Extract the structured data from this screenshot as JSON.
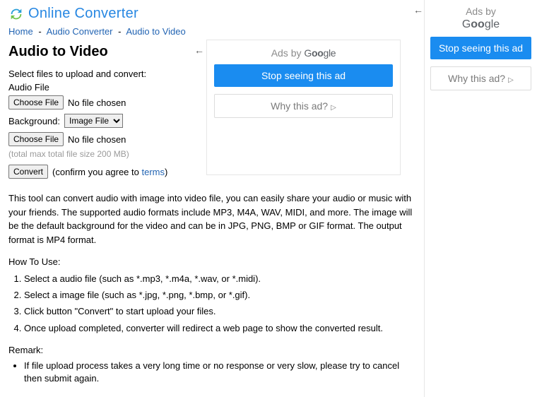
{
  "brand": "Online Converter",
  "breadcrumbs": {
    "home": "Home",
    "audio_converter": "Audio Converter",
    "current": "Audio to Video",
    "sep": "-"
  },
  "title": "Audio to Video",
  "form": {
    "select_files": "Select files to upload and convert:",
    "audio_label": "Audio File",
    "choose_file": "Choose File",
    "no_file": "No file chosen",
    "background_label": "Background:",
    "background_selected": "Image File",
    "max_hint": "(total max total file size 200 MB)",
    "convert": "Convert",
    "confirm_prefix": "(confirm you agree to ",
    "terms": "terms",
    "confirm_suffix": ")"
  },
  "ad": {
    "ads_by": "Ads by ",
    "google": "Google",
    "stop": "Stop seeing this ad",
    "why": "Why this ad?",
    "tri": "▷"
  },
  "description": "This tool can convert audio with image into video file, you can easily share your audio or music with your friends. The supported audio formats include MP3, M4A, WAV, MIDI, and more. The image will be the default background for the video and can be in JPG, PNG, BMP or GIF format. The output format is MP4 format.",
  "how_to_use_h": "How To Use:",
  "steps": [
    "Select a audio file (such as *.mp3, *.m4a, *.wav, or *.midi).",
    "Select a image file (such as *.jpg, *.png, *.bmp, or *.gif).",
    "Click button \"Convert\" to start upload your files.",
    "Once upload completed, converter will redirect a web page to show the converted result."
  ],
  "remark_h": "Remark:",
  "remarks": [
    "If file upload process takes a very long time or no response or very slow, please try to cancel then submit again."
  ]
}
